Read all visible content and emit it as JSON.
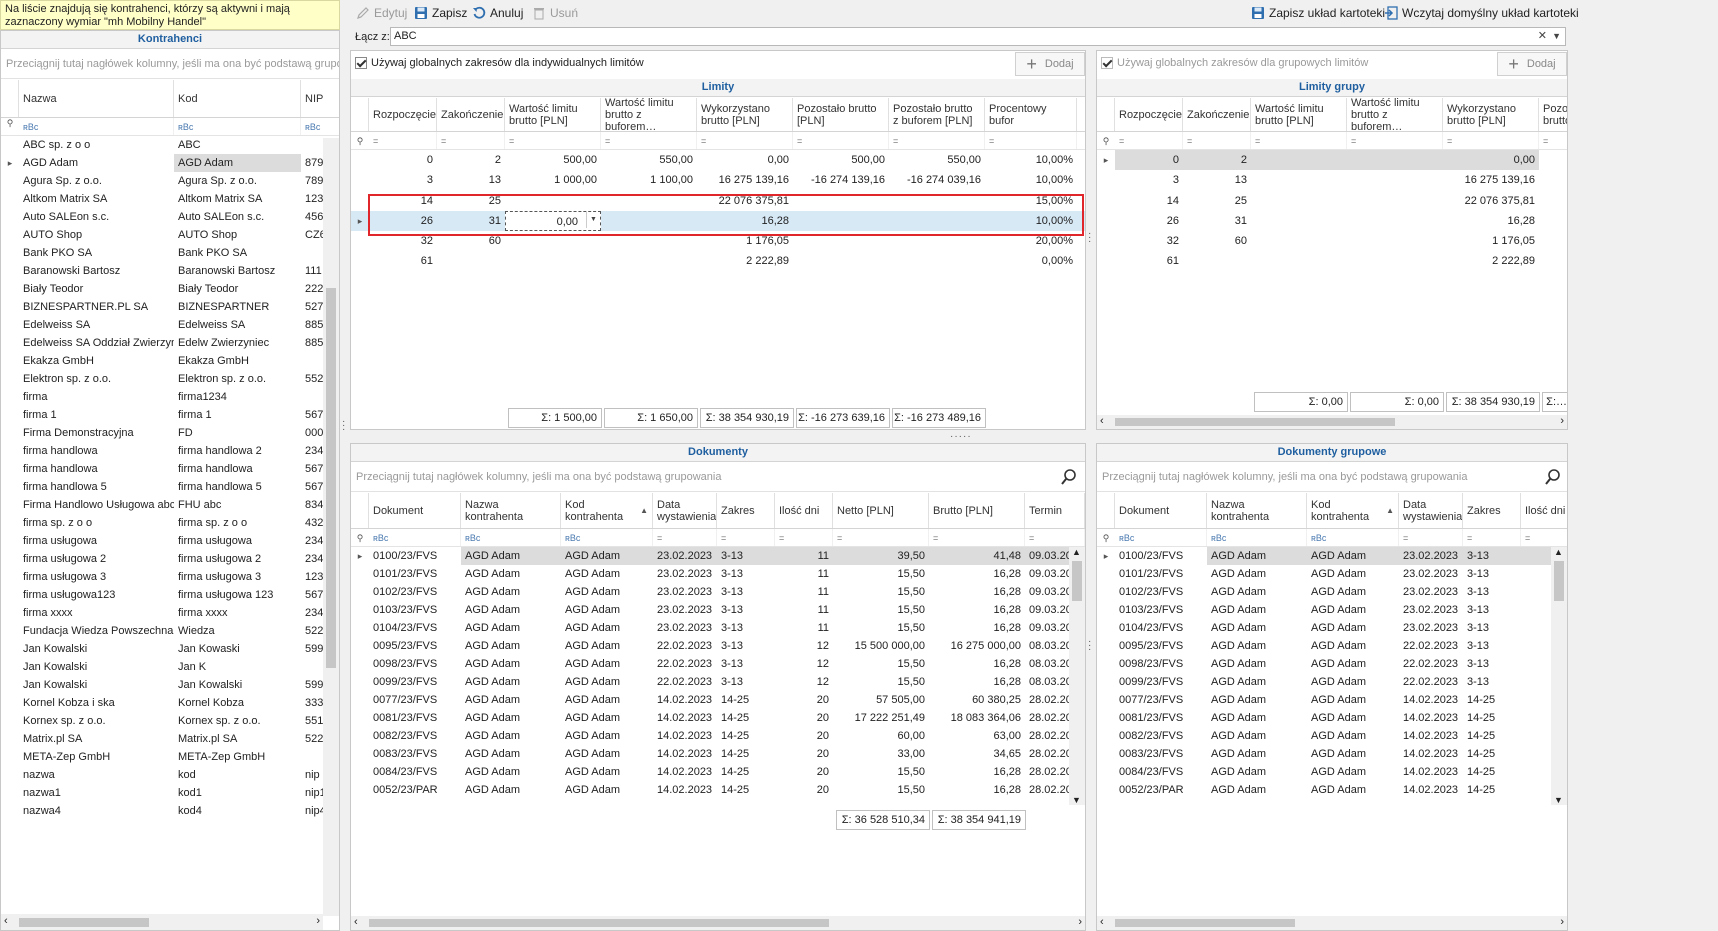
{
  "notice": "Na liście znajdują się kontrahenci, którzy są aktywni i mają zaznaczony wymiar \"mh Mobilny Handel\"",
  "toolbar": {
    "edit": "Edytuj",
    "save": "Zapisz",
    "cancel": "Anuluj",
    "delete": "Usuń",
    "save_layout": "Zapisz układ kartoteki",
    "load_default": "Wczytaj domyślny układ kartoteki"
  },
  "link": {
    "label": "Łącz z:",
    "value": "ABC"
  },
  "contractors": {
    "title": "Kontrahenci",
    "group_hint": "Przeciągnij tutaj nagłówek kolumny, jeśli ma ona być podstawą grupowania",
    "columns": [
      "Nazwa",
      "Kod",
      "NIP"
    ],
    "filter": "ʀBc",
    "rows": [
      [
        "ABC sp. z o o",
        "ABC",
        ""
      ],
      [
        "AGD Adam",
        "AGD Adam",
        "879"
      ],
      [
        "Agura Sp. z o.o.",
        "Agura Sp. z o.o.",
        "789"
      ],
      [
        "Altkom Matrix SA",
        "Altkom Matrix SA",
        "123"
      ],
      [
        "Auto SALEon s.c.",
        "Auto SALEon s.c.",
        "456"
      ],
      [
        "AUTO Shop",
        "AUTO Shop",
        "CZ6"
      ],
      [
        "Bank PKO SA",
        "Bank PKO SA",
        ""
      ],
      [
        "Baranowski Bartosz",
        "Baranowski Bartosz",
        "111"
      ],
      [
        "Biały Teodor",
        "Biały Teodor",
        "222"
      ],
      [
        "BIZNESPARTNER.PL SA",
        "BIZNESPARTNER",
        "527"
      ],
      [
        "Edelweiss SA",
        "Edelweiss SA",
        "885"
      ],
      [
        "Edelweiss SA Oddział Zwierzyniec",
        "Edelw Zwierzyniec",
        "885"
      ],
      [
        "Ekakza GmbH",
        "Ekakza GmbH",
        ""
      ],
      [
        "Elektron sp. z o.o.",
        "Elektron sp. z o.o.",
        "552"
      ],
      [
        "firma",
        "firma1234",
        ""
      ],
      [
        "firma 1",
        "firma 1",
        "567"
      ],
      [
        "Firma Demonstracyjna",
        "FD",
        "000"
      ],
      [
        "firma handlowa",
        "firma handlowa 2",
        "234"
      ],
      [
        "firma handlowa",
        "firma handlowa",
        "567"
      ],
      [
        "firma handlowa 5",
        "firma handlowa 5",
        "567"
      ],
      [
        "Firma Handlowo Usługowa abc",
        "FHU abc",
        "834"
      ],
      [
        "firma sp. z o o",
        "firma sp. z o o",
        "432"
      ],
      [
        "firma usługowa",
        "firma usługowa",
        "234"
      ],
      [
        "firma usługowa 2",
        "firma usługowa 2",
        "234"
      ],
      [
        "firma usługowa 3",
        "firma usługowa 3",
        "123"
      ],
      [
        "firma usługowa123",
        "firma usługowa 123",
        "567"
      ],
      [
        "firma xxxx",
        "firma xxxx",
        "234"
      ],
      [
        "Fundacja Wiedza Powszechna",
        "Wiedza",
        "522"
      ],
      [
        "Jan Kowalski",
        "Jan Kowaski",
        "599"
      ],
      [
        "Jan Kowalski",
        "Jan K",
        ""
      ],
      [
        "Jan Kowalski",
        "Jan Kowalski",
        "599"
      ],
      [
        "Kornel Kobza i ska",
        "Kornel Kobza",
        "333"
      ],
      [
        "Kornex sp. z o.o.",
        "Kornex sp. z o.o.",
        "551"
      ],
      [
        "Matrix.pl SA",
        "Matrix.pl SA",
        "522"
      ],
      [
        "META-Zep GmbH",
        "META-Zep GmbH",
        ""
      ],
      [
        "nazwa",
        "kod",
        "nip"
      ],
      [
        "nazwa1",
        "kod1",
        "nip1"
      ],
      [
        "nazwa4",
        "kod4",
        "nip4"
      ]
    ]
  },
  "limits": {
    "use_global": "Używaj globalnych zakresów dla indywidualnych limitów",
    "add": "Dodaj",
    "title": "Limity",
    "columns": [
      "Rozpoczęcie",
      "Zakończenie",
      "Wartość limitu brutto [PLN]",
      "Wartość limitu brutto z buforem…",
      "Wykorzystano brutto [PLN]",
      "Pozostało brutto [PLN]",
      "Pozostało brutto z buforem [PLN]",
      "Procentowy bufor"
    ],
    "rows": [
      [
        "0",
        "2",
        "500,00",
        "550,00",
        "0,00",
        "500,00",
        "550,00",
        "10,00%"
      ],
      [
        "3",
        "13",
        "1 000,00",
        "1 100,00",
        "16 275 139,16",
        "-16 274 139,16",
        "-16 274 039,16",
        "10,00%"
      ],
      [
        "14",
        "25",
        "",
        "",
        "22 076 375,81",
        "",
        "",
        "15,00%"
      ],
      [
        "26",
        "31",
        "0,00",
        "",
        "16,28",
        "",
        "",
        "10,00%"
      ],
      [
        "32",
        "60",
        "",
        "",
        "1 176,05",
        "",
        "",
        "20,00%"
      ],
      [
        "61",
        "",
        "",
        "",
        "2 222,89",
        "",
        "",
        "0,00%"
      ]
    ],
    "sums": [
      "Σ: 1 500,00",
      "Σ: 1 650,00",
      "Σ: 38 354 930,19",
      "Σ: -16 273 639,16",
      "Σ: -16 273 489,16"
    ]
  },
  "group_limits": {
    "use_global": "Używaj globalnych zakresów dla grupowych limitów",
    "add": "Dodaj",
    "title": "Limity grupy",
    "columns": [
      "Rozpoczęcie",
      "Zakończenie",
      "Wartość limitu brutto [PLN]",
      "Wartość limitu brutto z buforem…",
      "Wykorzystano brutto [PLN]",
      "Pozos brutto"
    ],
    "rows": [
      [
        "0",
        "2",
        "",
        "",
        "0,00"
      ],
      [
        "3",
        "13",
        "",
        "",
        "16 275 139,16"
      ],
      [
        "14",
        "25",
        "",
        "",
        "22 076 375,81"
      ],
      [
        "26",
        "31",
        "",
        "",
        "16,28"
      ],
      [
        "32",
        "60",
        "",
        "",
        "1 176,05"
      ],
      [
        "61",
        "",
        "",
        "",
        "2 222,89"
      ]
    ],
    "sums": [
      "Σ: 0,00",
      "Σ: 0,00",
      "Σ: 38 354 930,19",
      "Σ:…"
    ]
  },
  "documents": {
    "title": "Dokumenty",
    "group_hint": "Przeciągnij tutaj nagłówek kolumny, jeśli ma ona być podstawą grupowania",
    "columns": [
      "Dokument",
      "Nazwa kontrahenta",
      "Kod kontrahenta",
      "Data wystawienia",
      "Zakres",
      "Ilość dni",
      "Netto [PLN]",
      "Brutto [PLN]",
      "Termin"
    ],
    "rows": [
      [
        "0100/23/FVS",
        "AGD Adam",
        "AGD Adam",
        "23.02.2023",
        "3-13",
        "11",
        "39,50",
        "41,48",
        "09.03.20"
      ],
      [
        "0101/23/FVS",
        "AGD Adam",
        "AGD Adam",
        "23.02.2023",
        "3-13",
        "11",
        "15,50",
        "16,28",
        "09.03.20"
      ],
      [
        "0102/23/FVS",
        "AGD Adam",
        "AGD Adam",
        "23.02.2023",
        "3-13",
        "11",
        "15,50",
        "16,28",
        "09.03.20"
      ],
      [
        "0103/23/FVS",
        "AGD Adam",
        "AGD Adam",
        "23.02.2023",
        "3-13",
        "11",
        "15,50",
        "16,28",
        "09.03.20"
      ],
      [
        "0104/23/FVS",
        "AGD Adam",
        "AGD Adam",
        "23.02.2023",
        "3-13",
        "11",
        "15,50",
        "16,28",
        "09.03.20"
      ],
      [
        "0095/23/FVS",
        "AGD Adam",
        "AGD Adam",
        "22.02.2023",
        "3-13",
        "12",
        "15 500 000,00",
        "16 275 000,00",
        "08.03.20"
      ],
      [
        "0098/23/FVS",
        "AGD Adam",
        "AGD Adam",
        "22.02.2023",
        "3-13",
        "12",
        "15,50",
        "16,28",
        "08.03.20"
      ],
      [
        "0099/23/FVS",
        "AGD Adam",
        "AGD Adam",
        "22.02.2023",
        "3-13",
        "12",
        "15,50",
        "16,28",
        "08.03.20"
      ],
      [
        "0077/23/FVS",
        "AGD Adam",
        "AGD Adam",
        "14.02.2023",
        "14-25",
        "20",
        "57 505,00",
        "60 380,25",
        "28.02.20"
      ],
      [
        "0081/23/FVS",
        "AGD Adam",
        "AGD Adam",
        "14.02.2023",
        "14-25",
        "20",
        "17 222 251,49",
        "18 083 364,06",
        "28.02.20"
      ],
      [
        "0082/23/FVS",
        "AGD Adam",
        "AGD Adam",
        "14.02.2023",
        "14-25",
        "20",
        "60,00",
        "63,00",
        "28.02.20"
      ],
      [
        "0083/23/FVS",
        "AGD Adam",
        "AGD Adam",
        "14.02.2023",
        "14-25",
        "20",
        "33,00",
        "34,65",
        "28.02.20"
      ],
      [
        "0084/23/FVS",
        "AGD Adam",
        "AGD Adam",
        "14.02.2023",
        "14-25",
        "20",
        "15,50",
        "16,28",
        "28.02.20"
      ],
      [
        "0052/23/PAR",
        "AGD Adam",
        "AGD Adam",
        "14.02.2023",
        "14-25",
        "20",
        "15,50",
        "16,28",
        "28.02.20"
      ]
    ],
    "sums": [
      "Σ: 36 528 510,34",
      "Σ: 38 354 941,19"
    ]
  },
  "group_documents": {
    "title": "Dokumenty grupowe",
    "group_hint": "Przeciągnij tutaj nagłówek kolumny, jeśli ma ona być podstawą grupowania",
    "columns": [
      "Dokument",
      "Nazwa kontrahenta",
      "Kod kontrahenta",
      "Data wystawienia",
      "Zakres",
      "Ilość dni"
    ],
    "rows": [
      [
        "0100/23/FVS",
        "AGD Adam",
        "AGD Adam",
        "23.02.2023",
        "3-13"
      ],
      [
        "0101/23/FVS",
        "AGD Adam",
        "AGD Adam",
        "23.02.2023",
        "3-13"
      ],
      [
        "0102/23/FVS",
        "AGD Adam",
        "AGD Adam",
        "23.02.2023",
        "3-13"
      ],
      [
        "0103/23/FVS",
        "AGD Adam",
        "AGD Adam",
        "23.02.2023",
        "3-13"
      ],
      [
        "0104/23/FVS",
        "AGD Adam",
        "AGD Adam",
        "23.02.2023",
        "3-13"
      ],
      [
        "0095/23/FVS",
        "AGD Adam",
        "AGD Adam",
        "22.02.2023",
        "3-13"
      ],
      [
        "0098/23/FVS",
        "AGD Adam",
        "AGD Adam",
        "22.02.2023",
        "3-13"
      ],
      [
        "0099/23/FVS",
        "AGD Adam",
        "AGD Adam",
        "22.02.2023",
        "3-13"
      ],
      [
        "0077/23/FVS",
        "AGD Adam",
        "AGD Adam",
        "14.02.2023",
        "14-25"
      ],
      [
        "0081/23/FVS",
        "AGD Adam",
        "AGD Adam",
        "14.02.2023",
        "14-25"
      ],
      [
        "0082/23/FVS",
        "AGD Adam",
        "AGD Adam",
        "14.02.2023",
        "14-25"
      ],
      [
        "0083/23/FVS",
        "AGD Adam",
        "AGD Adam",
        "14.02.2023",
        "14-25"
      ],
      [
        "0084/23/FVS",
        "AGD Adam",
        "AGD Adam",
        "14.02.2023",
        "14-25"
      ],
      [
        "0052/23/PAR",
        "AGD Adam",
        "AGD Adam",
        "14.02.2023",
        "14-25"
      ]
    ]
  },
  "colors": {
    "title": "#1f5fa0",
    "notice_bg": "#ffffc8",
    "highlight": "#e0262a",
    "selected_row": "#dcdcdc",
    "active_row": "#d8e9f6"
  }
}
